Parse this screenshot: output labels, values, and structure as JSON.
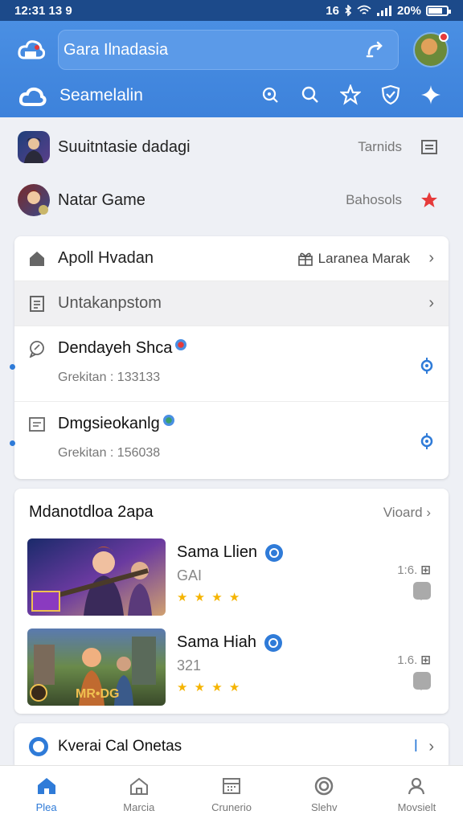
{
  "status_bar": {
    "time": "12:31 13 9",
    "battery": "20%",
    "indicator": "16"
  },
  "header": {
    "search_value": "Gara Ilnadasia",
    "section_label": "Seamelalin",
    "icons": [
      "search-target-icon",
      "search-icon",
      "star-icon",
      "shield-icon",
      "sparkle-icon"
    ]
  },
  "top_list": [
    {
      "title": "Suuitntasie dadagi",
      "sub": "Tarnids",
      "action_icon": "list-icon"
    },
    {
      "title": "Natar Game",
      "sub": "Bahosols",
      "action_icon": "star-icon"
    }
  ],
  "menu_card": {
    "rows": [
      {
        "label": "Apoll Hvadan",
        "right": "Laranea Marak",
        "icon": "home-icon",
        "shaded": false
      },
      {
        "label": "Untakanpstom",
        "right": "",
        "icon": "document-icon",
        "shaded": true
      }
    ],
    "items": [
      {
        "title": "Dendayeh Shca",
        "sub": "Grekitan : 133133",
        "icon": "chat-bubble-icon"
      },
      {
        "title": "Dmgsieokanlg",
        "sub": "Grekitan : 156038",
        "icon": "document-icon"
      }
    ]
  },
  "recommend": {
    "title": "Mdanotdloa 2apa",
    "view_all": "Vioard",
    "games": [
      {
        "name": "Sama Llien",
        "sub": "GAI",
        "value": "1:6.",
        "stars": "★ ★ ★ ★"
      },
      {
        "name": "Sama Hiah",
        "sub": "321",
        "value": "1.6.",
        "stars": "★ ★ ★ ★"
      }
    ]
  },
  "bottom_card": {
    "title": "Kverai Cal Onetas",
    "right_glyph": "ǀ"
  },
  "nav": [
    {
      "label": "Plea",
      "icon": "home-icon",
      "active": true
    },
    {
      "label": "Marcia",
      "icon": "store-icon",
      "active": false
    },
    {
      "label": "Crunerio",
      "icon": "calendar-icon",
      "active": false
    },
    {
      "label": "Slehv",
      "icon": "ring-icon",
      "active": false
    },
    {
      "label": "Movsielt",
      "icon": "user-icon",
      "active": false
    }
  ],
  "colors": {
    "primary": "#3d82db",
    "accent_red": "#e63a3a",
    "star": "#f5b400"
  }
}
